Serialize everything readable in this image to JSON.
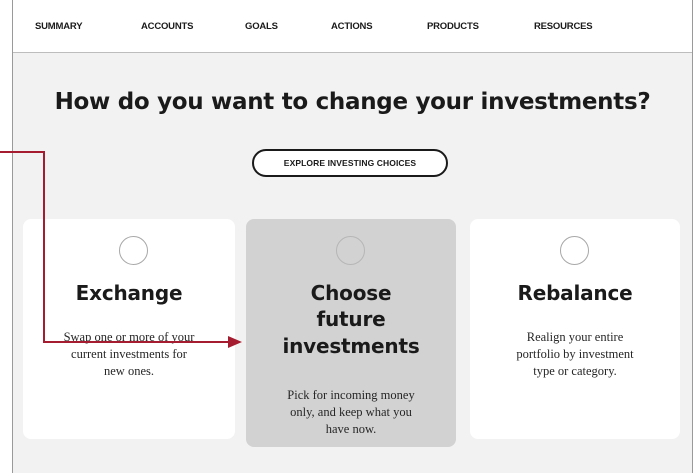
{
  "nav": {
    "items": [
      {
        "label": "SUMMARY"
      },
      {
        "label": "ACCOUNTS"
      },
      {
        "label": "GOALS"
      },
      {
        "label": "ACTIONS"
      },
      {
        "label": "PRODUCTS"
      },
      {
        "label": "RESOURCES"
      }
    ]
  },
  "main": {
    "headline": "How do you want to change your investments?",
    "explore_button": "EXPLORE INVESTING CHOICES",
    "cards": [
      {
        "title_lines": [
          "Exchange"
        ],
        "desc_lines": [
          "Swap one or more of your",
          "current investments for",
          "new ones."
        ],
        "selected": false
      },
      {
        "title_lines": [
          "Choose",
          "future",
          "investments"
        ],
        "desc_lines": [
          "Pick for incoming money",
          "only, and keep what you",
          "have now."
        ],
        "selected": true
      },
      {
        "title_lines": [
          "Rebalance"
        ],
        "desc_lines": [
          "Realign your entire",
          "portfolio by investment",
          "type or category."
        ],
        "selected": false
      }
    ]
  },
  "colors": {
    "annotation_arrow": "#a51c30",
    "selected_card": "#d2d2d2",
    "page_background": "#f2f2f2"
  },
  "icons": [
    "radio-button-icon",
    "annotation-arrow-icon"
  ]
}
